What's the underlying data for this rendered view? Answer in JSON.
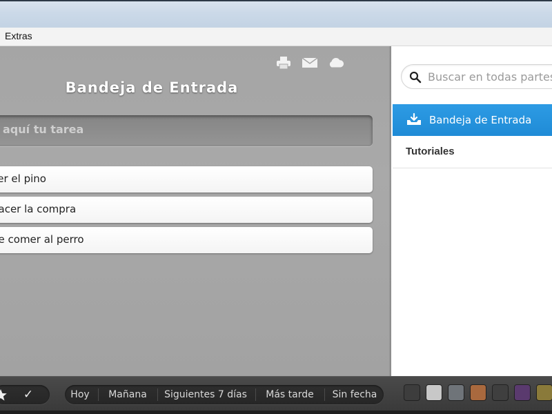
{
  "window": {
    "menu": [
      "Extras"
    ]
  },
  "list": {
    "title": "Bandeja de Entrada",
    "add_task_placeholder": "aquí tu tarea",
    "toolbar_icons": [
      "printer-icon",
      "mail-icon",
      "cloud-icon"
    ],
    "tasks": [
      {
        "label": "cer el pino"
      },
      {
        "label": "hacer la compra"
      },
      {
        "label": "de comer al perro"
      }
    ]
  },
  "sidebar": {
    "search_placeholder": "Buscar en todas partes",
    "items": [
      {
        "label": "Bandeja de Entrada",
        "active": true,
        "icon": "inbox-icon"
      },
      {
        "label": "Tutoriales",
        "active": false
      }
    ]
  },
  "footer": {
    "check_glyph": "✓",
    "filters": [
      "Hoy",
      "Mañana",
      "Siguientes 7 días",
      "Más tarde",
      "Sin fecha"
    ],
    "background_swatches": [
      "#3d3d3d",
      "#c8c8c8",
      "#6f7479",
      "#a9693e",
      "#3f3f3f",
      "#5a3a6e",
      "#8a7a3a"
    ]
  },
  "colors": {
    "accent": "#2693de",
    "main_background": "#a8a8a8",
    "footer_background": "#424242"
  }
}
